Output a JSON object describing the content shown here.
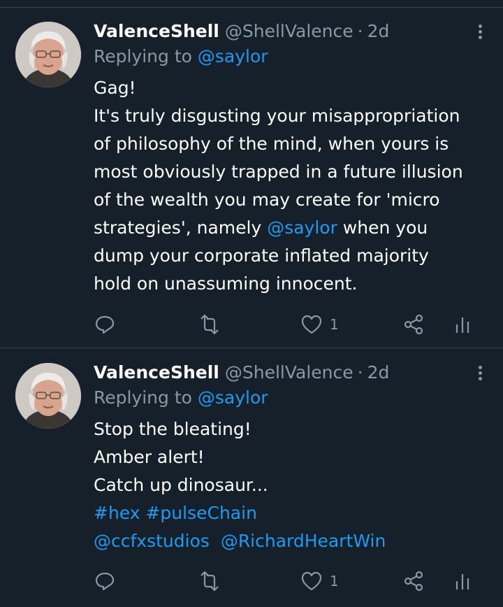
{
  "tweets": [
    {
      "display_name": "ValenceShell",
      "handle": "@ShellValence",
      "separator": "·",
      "time": "2d",
      "reply_prefix": "Replying to",
      "reply_to": "@saylor",
      "body_lines": [
        "Gag!",
        "It's truly disgusting your misappropriation",
        "of philosophy of the mind, when yours is",
        "most obviously trapped in a future illusion",
        "of the wealth you may create for 'micro"
      ],
      "body_line6_pre": "strategies', namely ",
      "body_line6_mention": "@saylor",
      "body_line6_post": " when you",
      "body_lines_end": [
        "dump your corporate inflated majority",
        "hold on unassuming innocent."
      ],
      "like_count": "1"
    },
    {
      "display_name": "ValenceShell",
      "handle": "@ShellValence",
      "separator": "·",
      "time": "2d",
      "reply_prefix": "Replying to",
      "reply_to": "@saylor",
      "body_lines": [
        "Stop the bleating!",
        "Amber alert!",
        "Catch up dinosaur..."
      ],
      "hashtags": [
        "#hex",
        "#pulseChain"
      ],
      "mentions": [
        "@ccfxstudios",
        "@RichardHeartWin"
      ],
      "like_count": "1"
    }
  ],
  "icons": [
    "more-icon",
    "reply-icon",
    "retweet-icon",
    "like-icon",
    "share-icon",
    "analytics-icon"
  ],
  "colors": {
    "background": "#15202b",
    "divider": "#38444d",
    "text": "#ffffff",
    "muted": "#8899a6",
    "link": "#1d9bf0"
  }
}
